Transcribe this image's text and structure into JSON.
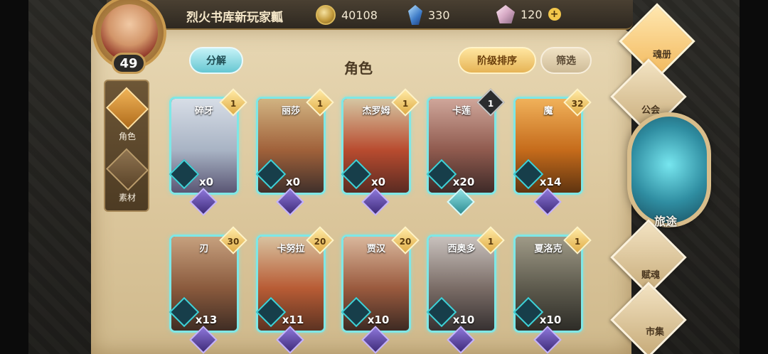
{
  "topbar": {
    "player_name": "烈火书库新玩家瓤",
    "gold": "40108",
    "crystal": "330",
    "gem": "120",
    "gem_plus": "+"
  },
  "avatar": {
    "level": "49"
  },
  "left_nav": [
    {
      "label": "角色",
      "icon": "character-icon",
      "active": true
    },
    {
      "label": "素材",
      "icon": "material-icon",
      "active": false
    }
  ],
  "header": {
    "decompose": "分解",
    "title": "角色",
    "sort": "阶级排序",
    "filter": "筛选"
  },
  "cards": [
    {
      "name": "碎牙",
      "count": "x0",
      "badge": "1",
      "badge_style": "gold",
      "tip": "purple"
    },
    {
      "name": "丽莎",
      "count": "x0",
      "badge": "1",
      "badge_style": "gold",
      "tip": "purple"
    },
    {
      "name": "杰罗姆",
      "count": "x0",
      "badge": "1",
      "badge_style": "gold",
      "tip": "purple"
    },
    {
      "name": "卡莲",
      "count": "x20",
      "badge": "1",
      "badge_style": "dark",
      "tip": "teal"
    },
    {
      "name": "魔",
      "count": "x14",
      "badge": "32",
      "badge_style": "gold",
      "tip": "purple"
    },
    {
      "name": "刃",
      "count": "x13",
      "badge": "30",
      "badge_style": "gold",
      "tip": "purple"
    },
    {
      "name": "卡努拉",
      "count": "x11",
      "badge": "20",
      "badge_style": "gold",
      "tip": "purple"
    },
    {
      "name": "贾汉",
      "count": "x10",
      "badge": "20",
      "badge_style": "gold",
      "tip": "purple"
    },
    {
      "name": "西奥多",
      "count": "x10",
      "badge": "1",
      "badge_style": "gold",
      "tip": "purple"
    },
    {
      "name": "夏洛克",
      "count": "x10",
      "badge": "1",
      "badge_style": "gold",
      "tip": "purple"
    }
  ],
  "right_nav": {
    "soul_book": "魂册",
    "guild": "公会",
    "journey": "旅途",
    "soul_gift": "赋魂",
    "market": "市集"
  }
}
